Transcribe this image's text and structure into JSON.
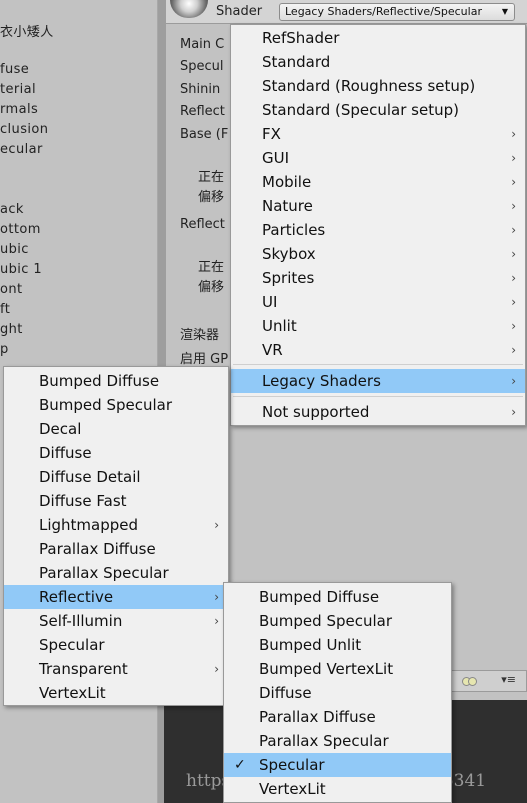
{
  "left_panel": {
    "items": [
      "衣小矮人",
      "fuse",
      "terial",
      "rmals",
      "clusion",
      "ecular",
      "ack",
      "ottom",
      "ubic",
      "ubic 1",
      "ont",
      "ft",
      "ght",
      "p"
    ]
  },
  "inspector": {
    "shader_label": "Shader",
    "shader_value": "Legacy Shaders/Reflective/Specular",
    "dropdown_arrow": "▼",
    "rows": [
      "Main C",
      "Specul",
      "Shinin",
      "Reflect",
      "Base (F",
      "正在",
      "偏移",
      "Reflect",
      "正在",
      "偏移",
      "渲染器",
      "启用 GP"
    ]
  },
  "preview_bar": {
    "menu_icon": "▾≡"
  },
  "watermark": "https://blog.csdn.net/qq_15505341",
  "shader_menu": {
    "items": [
      {
        "label": "RefShader",
        "submenu": false
      },
      {
        "label": "Standard",
        "submenu": false
      },
      {
        "label": "Standard (Roughness setup)",
        "submenu": false
      },
      {
        "label": "Standard (Specular setup)",
        "submenu": false
      },
      {
        "label": "FX",
        "submenu": true
      },
      {
        "label": "GUI",
        "submenu": true
      },
      {
        "label": "Mobile",
        "submenu": true
      },
      {
        "label": "Nature",
        "submenu": true
      },
      {
        "label": "Particles",
        "submenu": true
      },
      {
        "label": "Skybox",
        "submenu": true
      },
      {
        "label": "Sprites",
        "submenu": true
      },
      {
        "label": "UI",
        "submenu": true
      },
      {
        "label": "Unlit",
        "submenu": true
      },
      {
        "label": "VR",
        "submenu": true
      }
    ],
    "legacy_label": "Legacy Shaders",
    "not_supported_label": "Not supported",
    "arrow": "›"
  },
  "legacy_menu": {
    "items": [
      {
        "label": "Bumped Diffuse",
        "submenu": false
      },
      {
        "label": "Bumped Specular",
        "submenu": false
      },
      {
        "label": "Decal",
        "submenu": false
      },
      {
        "label": "Diffuse",
        "submenu": false
      },
      {
        "label": "Diffuse Detail",
        "submenu": false
      },
      {
        "label": "Diffuse Fast",
        "submenu": false
      },
      {
        "label": "Lightmapped",
        "submenu": true
      },
      {
        "label": "Parallax Diffuse",
        "submenu": false
      },
      {
        "label": "Parallax Specular",
        "submenu": false
      },
      {
        "label": "Reflective",
        "submenu": true,
        "highlighted": true
      },
      {
        "label": "Self-Illumin",
        "submenu": true
      },
      {
        "label": "Specular",
        "submenu": false
      },
      {
        "label": "Transparent",
        "submenu": true
      },
      {
        "label": "VertexLit",
        "submenu": false
      }
    ]
  },
  "reflective_menu": {
    "items": [
      {
        "label": "Bumped Diffuse",
        "checked": false
      },
      {
        "label": "Bumped Specular",
        "checked": false
      },
      {
        "label": "Bumped Unlit",
        "checked": false
      },
      {
        "label": "Bumped VertexLit",
        "checked": false
      },
      {
        "label": "Diffuse",
        "checked": false
      },
      {
        "label": "Parallax Diffuse",
        "checked": false
      },
      {
        "label": "Parallax Specular",
        "checked": false
      },
      {
        "label": "Specular",
        "checked": true,
        "highlighted": true
      },
      {
        "label": "VertexLit",
        "checked": false
      }
    ],
    "check_mark": "✓"
  },
  "colors": {
    "highlight": "#91c9f7",
    "menu_bg": "#f0f0f0",
    "editor_bg": "#c2c2c2"
  }
}
